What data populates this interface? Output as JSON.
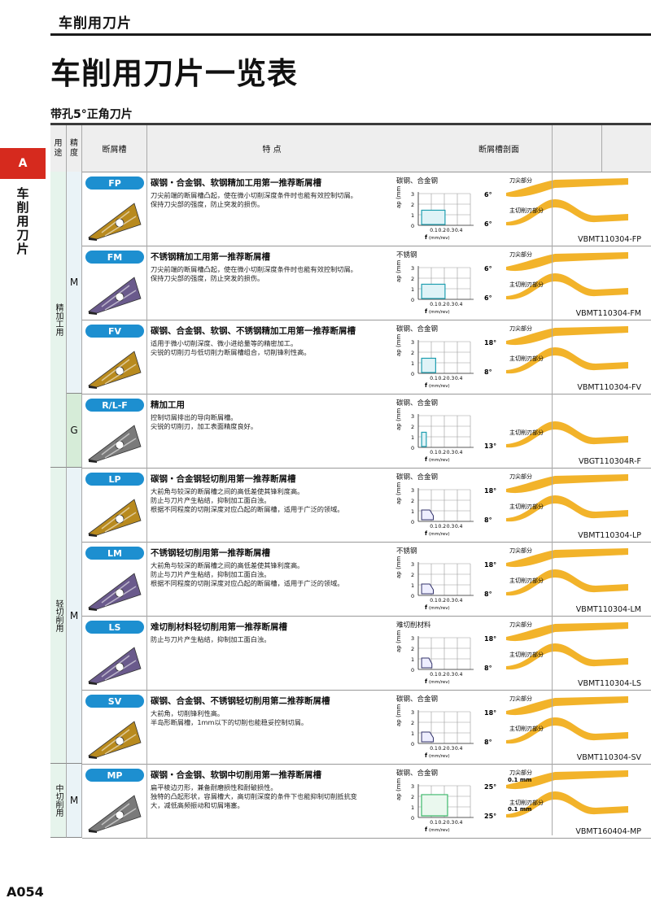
{
  "header": {
    "title": "车削用刀片"
  },
  "page_title": "车削用刀片一览表",
  "sub_title": "带孔5°正角刀片",
  "side_tab": {
    "letter": "A",
    "label": "车削用刀片"
  },
  "page_number": "A054",
  "columns": {
    "usage": "用途",
    "precision": "精度",
    "breaker": "断屑槽",
    "features": "特 点",
    "profile": "断屑槽剖面"
  },
  "graph_axis": {
    "y_label": "ap (mm)",
    "x_label": "f",
    "x_unit": "(mm/rev)",
    "y_ticks": [
      "3",
      "2",
      "1",
      "0"
    ],
    "x_ticks": [
      "0.1",
      "0.2",
      "0.3",
      "0.4"
    ]
  },
  "profile_labels": {
    "tip": "刀尖部分",
    "main": "主切削刃部分"
  },
  "groups": [
    {
      "label": "精加工用",
      "precision_groups": [
        {
          "label": "M"
        },
        {
          "label": "G"
        }
      ]
    },
    {
      "label": "轻切削用",
      "precision_groups": [
        {
          "label": "M"
        }
      ]
    },
    {
      "label": "中切削用",
      "precision_groups": [
        {
          "label": "M"
        }
      ]
    }
  ],
  "rows": [
    {
      "code": "FP",
      "title": "碳钢・合金钢、软钢精加工用第一推荐断屑槽",
      "lines": [
        "刀尖前端的断屑槽凸起，使在微小切削深度条件时也能有效控制切屑。",
        "保持刀尖部的强度，防止突发的损伤。"
      ],
      "material": "碳钢、合金钢",
      "model": "VBMT110304-FP",
      "angle_top": "6°",
      "angle_bottom": "6°"
    },
    {
      "code": "FM",
      "title": "不锈钢精加工用第一推荐断屑槽",
      "lines": [
        "刀尖前端的断屑槽凸起，使在微小切削深度条件时也能有效控制切屑。",
        "保持刀尖部的强度，防止突发的损伤。"
      ],
      "material": "不锈钢",
      "model": "VBMT110304-FM",
      "angle_top": "6°",
      "angle_bottom": "6°"
    },
    {
      "code": "FV",
      "title": "碳钢、合金钢、软钢、不锈钢精加工用第一推荐断屑槽",
      "lines": [
        "适用于微小切削深度、微小进给量等的精密加工。",
        "尖锐的切削刃与低切削力断屑槽组合，切削锋利性高。"
      ],
      "material": "碳钢、合金钢",
      "model": "VBMT110304-FV",
      "angle_top": "18°",
      "angle_bottom": "8°"
    },
    {
      "code": "R/L-F",
      "title": "精加工用",
      "lines": [
        "控制切屑排出的导向断屑槽。",
        "尖锐的切削刃，加工表面精度良好。"
      ],
      "material": "碳钢、合金钢",
      "model": "VBGT110304R-F",
      "angle_top": "",
      "angle_bottom": "13°"
    },
    {
      "code": "LP",
      "title": "碳钢・合金钢轻切削用第一推荐断屑槽",
      "lines": [
        "大前角与较深的断屑槽之间的高低差使其锋利度高。",
        "防止与刀片产生粘结，抑制加工面白浊。",
        "根据不同程度的切削深度对应凸起的断屑槽，适用于广泛的领域。"
      ],
      "material": "碳钢、合金钢",
      "model": "VBMT110304-LP",
      "angle_top": "18°",
      "angle_bottom": "8°"
    },
    {
      "code": "LM",
      "title": "不锈钢轻切削用第一推荐断屑槽",
      "lines": [
        "大前角与较深的断屑槽之间的高低差使其锋利度高。",
        "防止与刀片产生粘结，抑制加工面白浊。",
        "根据不同程度的切削深度对应凸起的断屑槽，适用于广泛的领域。"
      ],
      "material": "不锈钢",
      "model": "VBMT110304-LM",
      "angle_top": "18°",
      "angle_bottom": "8°"
    },
    {
      "code": "LS",
      "title": "难切削材料轻切削用第一推荐断屑槽",
      "lines": [
        "防止与刀片产生粘结，抑制加工面白浊。"
      ],
      "material": "难切削材料",
      "model": "VBMT110304-LS",
      "angle_top": "18°",
      "angle_bottom": "8°"
    },
    {
      "code": "SV",
      "title": "碳钢、合金钢、不锈钢轻切削用第二推荐断屑槽",
      "lines": [
        "大前角，切削锋利性高。",
        "半岛形断屑槽，1mm以下的切削也能稳妥控制切屑。"
      ],
      "material": "碳钢、合金钢",
      "model": "VBMT110304-SV",
      "angle_top": "18°",
      "angle_bottom": "8°"
    },
    {
      "code": "MP",
      "title": "碳钢・合金钢、软钢中切削用第一推荐断屑槽",
      "lines": [
        "扁平棱边刃形，兼备耐磨损性和耐破损性。",
        "独特的凸起形状，容屑槽大，高切削深度的条件下也能抑制切削抵抗变",
        "大，减低高频振动和切屑堵塞。"
      ],
      "material": "碳钢、合金钢",
      "model": "VBMT160404-MP",
      "angle_top": "25°",
      "angle_bottom": "25°",
      "land_top": "0.1 mm",
      "land_bottom": "0.1 mm"
    }
  ],
  "colors": {
    "badge": "#1d8fd0",
    "tab": "#d62a1e",
    "profile_fill": "#f2b32a",
    "usage_bg": "#e6f4ec",
    "graph_box": "#1f9fb0"
  }
}
